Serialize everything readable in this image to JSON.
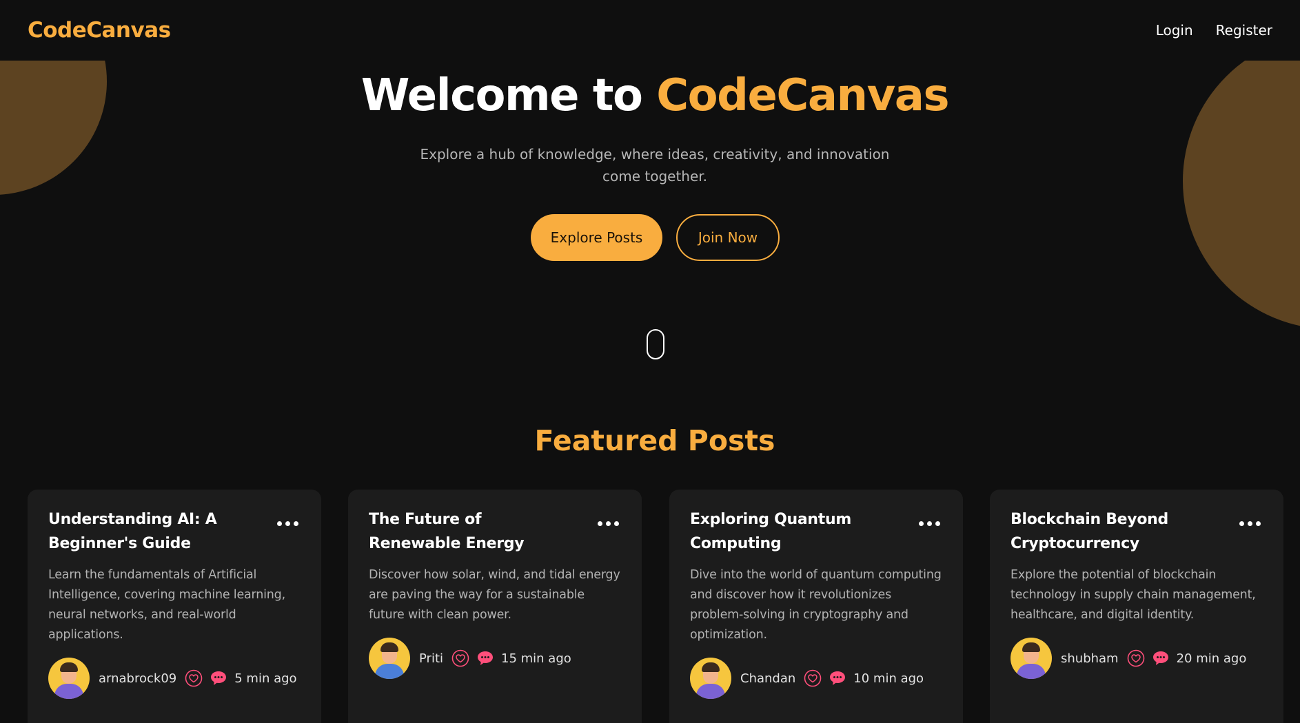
{
  "navbar": {
    "logo": "CodeCanvas",
    "links": [
      "Login",
      "Register"
    ]
  },
  "hero": {
    "title_prefix": "Welcome to ",
    "title_accent": "CodeCanvas",
    "subtitle": "Explore a hub of knowledge, where ideas, creativity, and innovation come together.",
    "primary_button": "Explore Posts",
    "secondary_button": "Join Now"
  },
  "featured": {
    "title": "Featured Posts",
    "posts": [
      {
        "title": "Understanding AI: A Beginner's Guide",
        "description": "Learn the fundamentals of Artificial Intelligence, covering machine learning, neural networks, and real-world applications.",
        "author": "arnabrock09",
        "time": "5 min ago"
      },
      {
        "title": "The Future of Renewable Energy",
        "description": "Discover how solar, wind, and tidal energy are paving the way for a sustainable future with clean power.",
        "author": "Priti",
        "time": "15 min ago"
      },
      {
        "title": "Exploring Quantum Computing",
        "description": "Dive into the world of quantum computing and discover how it revolutionizes problem-solving in cryptography and optimization.",
        "author": "Chandan",
        "time": "10 min ago"
      },
      {
        "title": "Blockchain Beyond Cryptocurrency",
        "description": "Explore the potential of blockchain technology in supply chain management, healthcare, and digital identity.",
        "author": "shubham",
        "time": "20 min ago"
      }
    ]
  },
  "colors": {
    "accent": "#f9ad3f",
    "background": "#0f0f0f",
    "card": "#1c1c1c",
    "blob": "#5d4321",
    "like": "#ff4f7b"
  },
  "icons": {
    "card_menu": "more-horizontal-icon",
    "like": "heart-icon",
    "comment": "comment-icon",
    "scroll": "mouse-scroll-icon"
  }
}
